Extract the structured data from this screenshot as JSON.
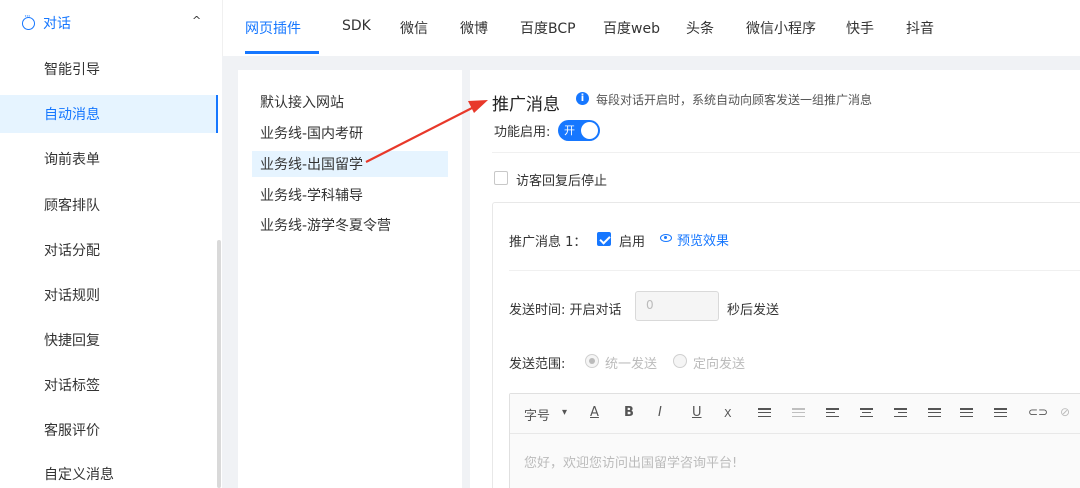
{
  "sidebar": {
    "group_label": "对话",
    "items": [
      {
        "label": "智能引导"
      },
      {
        "label": "自动消息"
      },
      {
        "label": "询前表单"
      },
      {
        "label": "顾客排队"
      },
      {
        "label": "对话分配"
      },
      {
        "label": "对话规则"
      },
      {
        "label": "快捷回复"
      },
      {
        "label": "对话标签"
      },
      {
        "label": "客服评价"
      },
      {
        "label": "自定义消息"
      }
    ],
    "active_index": 1
  },
  "tabs": [
    "网页插件",
    "SDK",
    "微信",
    "微博",
    "百度BCP",
    "百度web",
    "头条",
    "微信小程序",
    "快手",
    "抖音"
  ],
  "business_lines": [
    "默认接入网站",
    "业务线-国内考研",
    "业务线-出国留学",
    "业务线-学科辅导",
    "业务线-游学冬夏令营"
  ],
  "main": {
    "title": "推广消息",
    "info_text": "每段对话开启时，系统自动向顾客发送一组推广消息",
    "func_label": "功能启用:",
    "switch_label": "开",
    "stop_on_reply_label": "访客回复后停止",
    "promo_label": "推广消息 1：",
    "enable_label": "启用",
    "preview_label": "预览效果",
    "send_time_label": "发送时间:  开启对话",
    "delay_placeholder": "0",
    "after_send_label": "秒后发送",
    "scope_label": "发送范围:",
    "scope_options": [
      "统一发送",
      "定向发送"
    ],
    "toolbar": {
      "font_size": "字号",
      "caret": "▾",
      "underline_a": "A",
      "bold": "B",
      "italic": "I",
      "underline": "U",
      "clear": "Ⅹ"
    },
    "editor_placeholder": "您好，欢迎您访问出国留学咨询平台!"
  },
  "colors": {
    "accent": "#1677ff",
    "arrow": "#e8382a"
  }
}
